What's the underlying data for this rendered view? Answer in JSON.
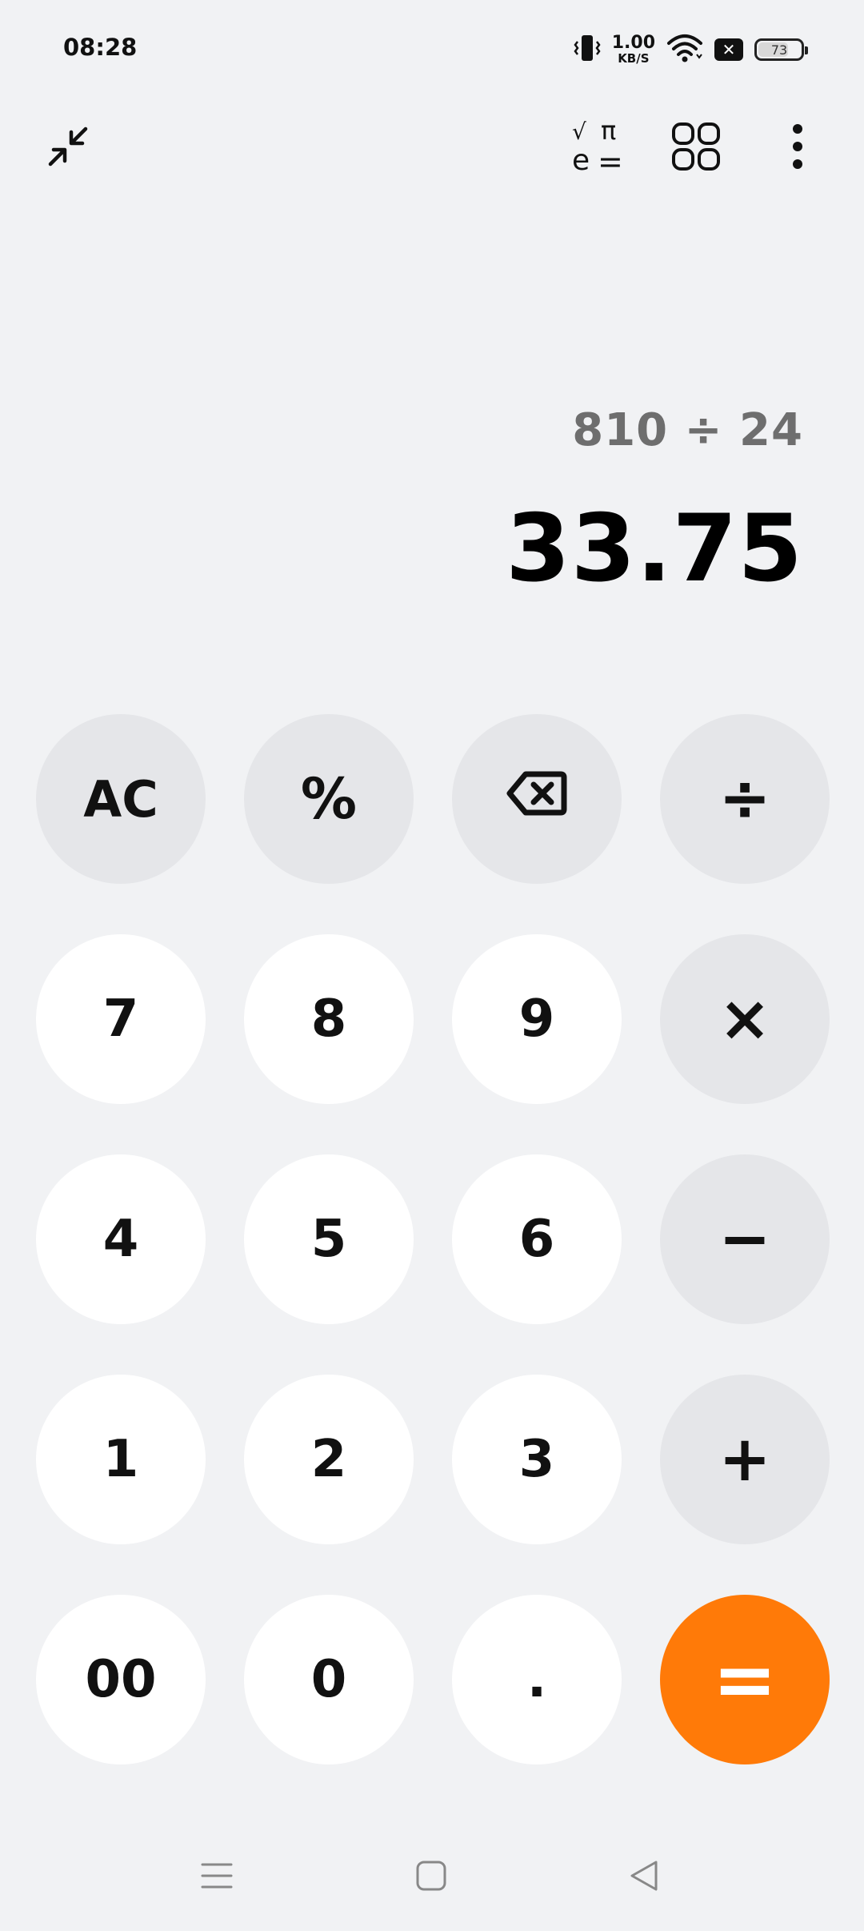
{
  "status_bar": {
    "time": "08:28",
    "net_speed_value": "1.00",
    "net_speed_unit": "KB/S",
    "battery_level": "73",
    "battery_percent": 73
  },
  "toolbar": {
    "sci_symbols": {
      "sqrt": "√",
      "pi": "π",
      "e": "e",
      "eq": "="
    },
    "icons": [
      "collapse-icon",
      "scientific-mode-icon",
      "converter-grid-icon",
      "more-options-icon"
    ]
  },
  "display": {
    "expression": "810 ÷ 24",
    "result": "33.75"
  },
  "keypad": {
    "ac": "AC",
    "percent": "%",
    "divide": "÷",
    "multiply": "×",
    "minus": "−",
    "plus": "+",
    "equals": "=",
    "seven": "7",
    "eight": "8",
    "nine": "9",
    "four": "4",
    "five": "5",
    "six": "6",
    "one": "1",
    "two": "2",
    "three": "3",
    "double_zero": "00",
    "zero": "0",
    "dot": "."
  },
  "colors": {
    "background": "#f1f2f4",
    "number_key": "#ffffff",
    "operator_key": "#e5e6e9",
    "equals_key": "#ff7a08"
  }
}
